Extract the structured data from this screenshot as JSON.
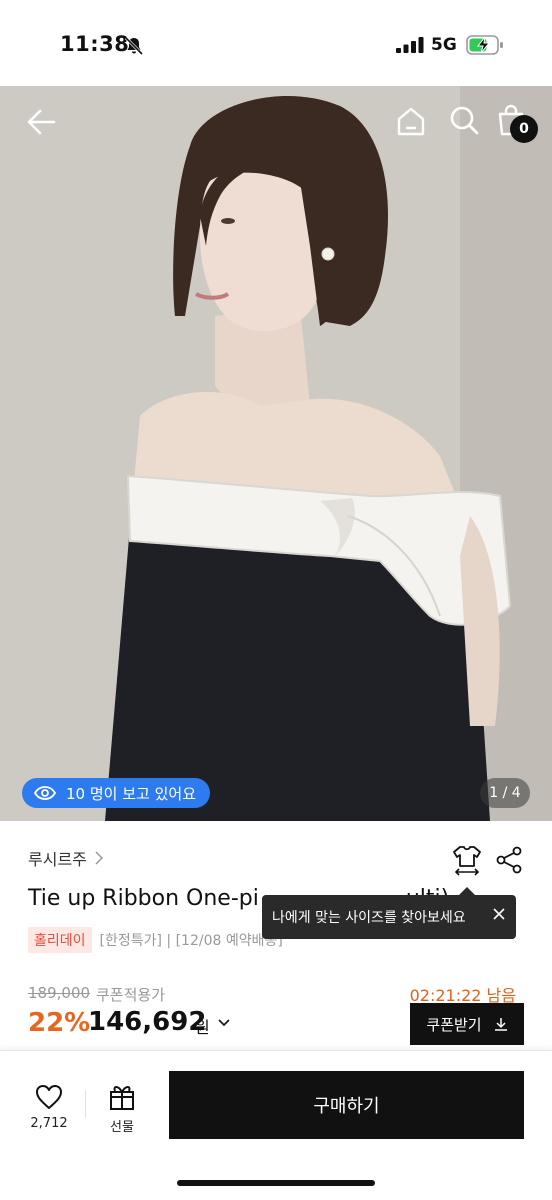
{
  "status_bar": {
    "time": "11:38",
    "network": "5G"
  },
  "hero": {
    "cart_count": "0",
    "viewers_text": "10 명이 보고 있어요",
    "page_indicator": "1 / 4"
  },
  "product": {
    "brand": "루시르주",
    "title": "Tie up Ribbon One-pi",
    "title_tail": "ulti)",
    "size_tooltip": "나에게 맞는 사이즈를 찾아보세요",
    "holiday_badge": "홀리데이",
    "tags_text": "[한정특가] | [12/08 예약배송]",
    "original_price": "189,000",
    "coupon_applied": "쿠폰적용가",
    "countdown": "02:21:22 남음",
    "discount": "22%",
    "final_price": "146,692",
    "won": "원",
    "coupon_button": "쿠폰받기"
  },
  "bottom_bar": {
    "like_count": "2,712",
    "gift_label": "선물",
    "buy_label": "구매하기"
  },
  "colors": {
    "accent_blue": "#2e7bf0",
    "discount_orange": "#e8651d",
    "holiday_red": "#e74c3c",
    "black": "#111111"
  }
}
